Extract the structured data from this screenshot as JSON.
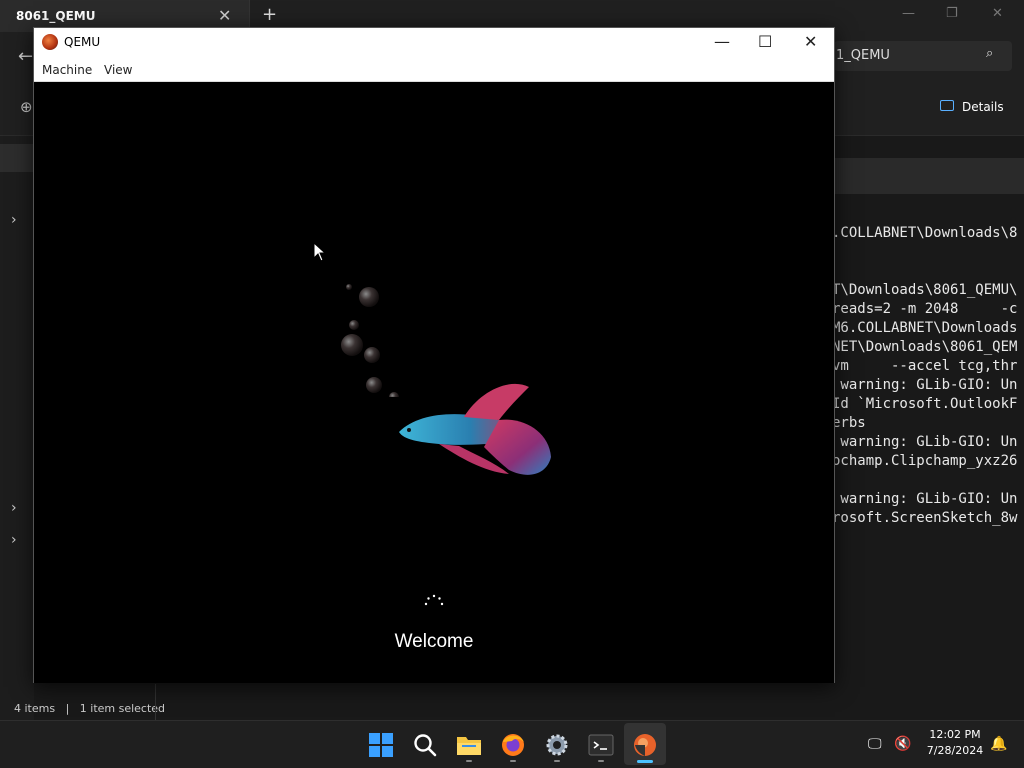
{
  "explorer": {
    "tab_title": "8061_QEMU",
    "tab_close": "✕",
    "new_tab": "+",
    "search_value": "1_QEMU",
    "details_label": "Details",
    "status_items": "4 items",
    "status_selected": "1 item selected"
  },
  "terminal": {
    "lines": [
      ".COLLABNET\\Downloads\\8",
      "",
      "",
      "T\\Downloads\\8061_QEMU\\",
      "reads=2 -m 2048     -c",
      "M6.COLLABNET\\Downloads",
      "NET\\Downloads\\8061_QEM",
      "vm     --accel tcg,thr",
      " warning: GLib-GIO: Un",
      "Id `Microsoft.OutlookF",
      "erbs",
      " warning: GLib-GIO: Un",
      "ochamp.Clipchamp_yxz26",
      "",
      " warning: GLib-GIO: Un",
      "rosoft.ScreenSketch_8w"
    ]
  },
  "qemu": {
    "title": "QEMU",
    "menu": [
      "Machine",
      "View"
    ],
    "welcome_text": "Welcome"
  },
  "taskbar": {
    "time": "12:02 PM",
    "date": "7/28/2024",
    "apps": [
      "windows-start-icon",
      "search-icon",
      "file-explorer-icon",
      "firefox-icon",
      "settings-icon",
      "terminal-icon",
      "qemu-icon"
    ]
  },
  "colors": {
    "accent": "#4cc2ff",
    "explorer_bg": "#191919",
    "qemu_screen": "#000000"
  }
}
